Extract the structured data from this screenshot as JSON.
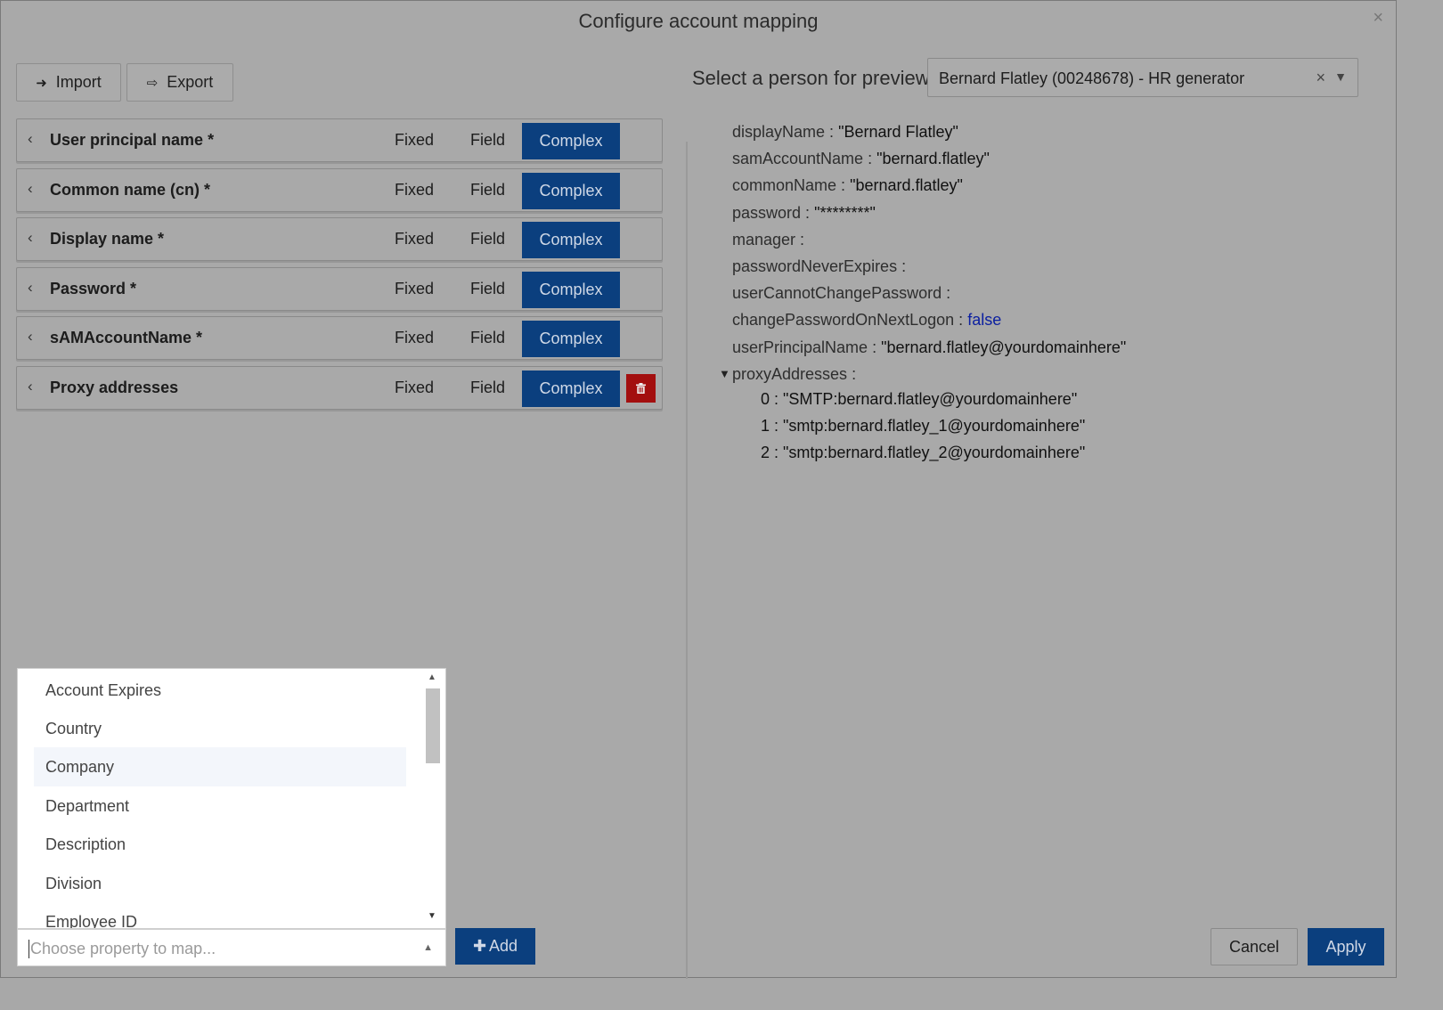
{
  "dialog": {
    "title": "Configure account mapping",
    "close_glyph": "×"
  },
  "toolbar": {
    "import_label": "Import",
    "export_label": "Export",
    "import_icon": "sign-in-icon",
    "export_icon": "sign-out-icon"
  },
  "mappings": [
    {
      "name": "User principal name *",
      "fixed": "Fixed",
      "field": "Field",
      "complex": "Complex",
      "selected": "Complex"
    },
    {
      "name": "Common name (cn) *",
      "fixed": "Fixed",
      "field": "Field",
      "complex": "Complex",
      "selected": "Complex"
    },
    {
      "name": "Display name *",
      "fixed": "Fixed",
      "field": "Field",
      "complex": "Complex",
      "selected": "Complex"
    },
    {
      "name": "Password *",
      "fixed": "Fixed",
      "field": "Field",
      "complex": "Complex",
      "selected": "Complex"
    },
    {
      "name": "sAMAccountName *",
      "fixed": "Fixed",
      "field": "Field",
      "complex": "Complex",
      "selected": "Complex"
    },
    {
      "name": "Proxy addresses",
      "fixed": "Fixed",
      "field": "Field",
      "complex": "Complex",
      "selected": "Complex",
      "deletable": true
    }
  ],
  "preview": {
    "label": "Select a person for preview",
    "selected_person": "Bernard Flatley (00248678) - HR generator",
    "clear_glyph": "×",
    "properties": [
      {
        "key": "displayName",
        "sep": " : ",
        "value": "\"Bernard Flatley\""
      },
      {
        "key": "samAccountName",
        "sep": " : ",
        "value": "\"bernard.flatley\""
      },
      {
        "key": "commonName",
        "sep": " : ",
        "value": "\"bernard.flatley\""
      },
      {
        "key": "password",
        "sep": " : ",
        "value": "\"********\""
      },
      {
        "key": "manager",
        "sep": " :",
        "value": ""
      },
      {
        "key": "passwordNeverExpires",
        "sep": " :",
        "value": ""
      },
      {
        "key": "userCannotChangePassword",
        "sep": " :",
        "value": ""
      },
      {
        "key": "changePasswordOnNextLogon",
        "sep": " : ",
        "value": "false"
      },
      {
        "key": "userPrincipalName",
        "sep": " : ",
        "value": "\"bernard.flatley@yourdomainhere\""
      },
      {
        "key": "proxyAddresses",
        "sep": " :",
        "value": ""
      }
    ],
    "proxy_addresses": [
      "0 : \"SMTP:bernard.flatley@yourdomainhere\"",
      "1 : \"smtp:bernard.flatley_1@yourdomainhere\"",
      "2 : \"smtp:bernard.flatley_2@yourdomainhere\""
    ],
    "expand_glyph": "▼",
    "boolean_color": "#0b1fa0"
  },
  "property_dropdown": {
    "options": [
      "Account Expires",
      "Country",
      "Company",
      "Department",
      "Description",
      "Division",
      "Employee ID"
    ],
    "highlighted": "Company",
    "placeholder": "Choose property to map...",
    "add_label": "Add"
  },
  "footer": {
    "cancel_label": "Cancel",
    "apply_label": "Apply"
  },
  "colors": {
    "primary": "#0b3f7e",
    "danger": "#a30f0f",
    "overlay_bg": "#a9a9a9"
  }
}
